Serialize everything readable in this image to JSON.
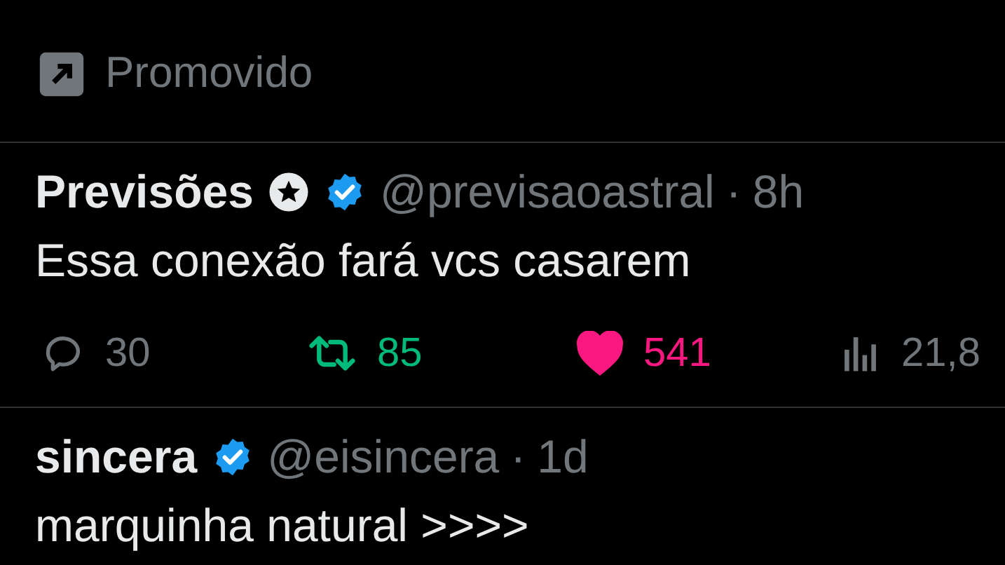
{
  "promoted": {
    "label": "Promovido"
  },
  "tweets": [
    {
      "name": "Previsões",
      "star_badge": true,
      "verified": true,
      "handle": "@previsaoastral",
      "dot": "·",
      "time": "8h",
      "text": "Essa conexão fará vcs casarem",
      "actions": {
        "replies": "30",
        "reposts": "85",
        "reposted": true,
        "likes": "541",
        "liked": true,
        "views": "21,8"
      }
    },
    {
      "name": "sincera",
      "star_badge": false,
      "verified": true,
      "handle": "@eisincera",
      "dot": "·",
      "time": "1d",
      "text": "marquinha natural >>>>"
    }
  ]
}
